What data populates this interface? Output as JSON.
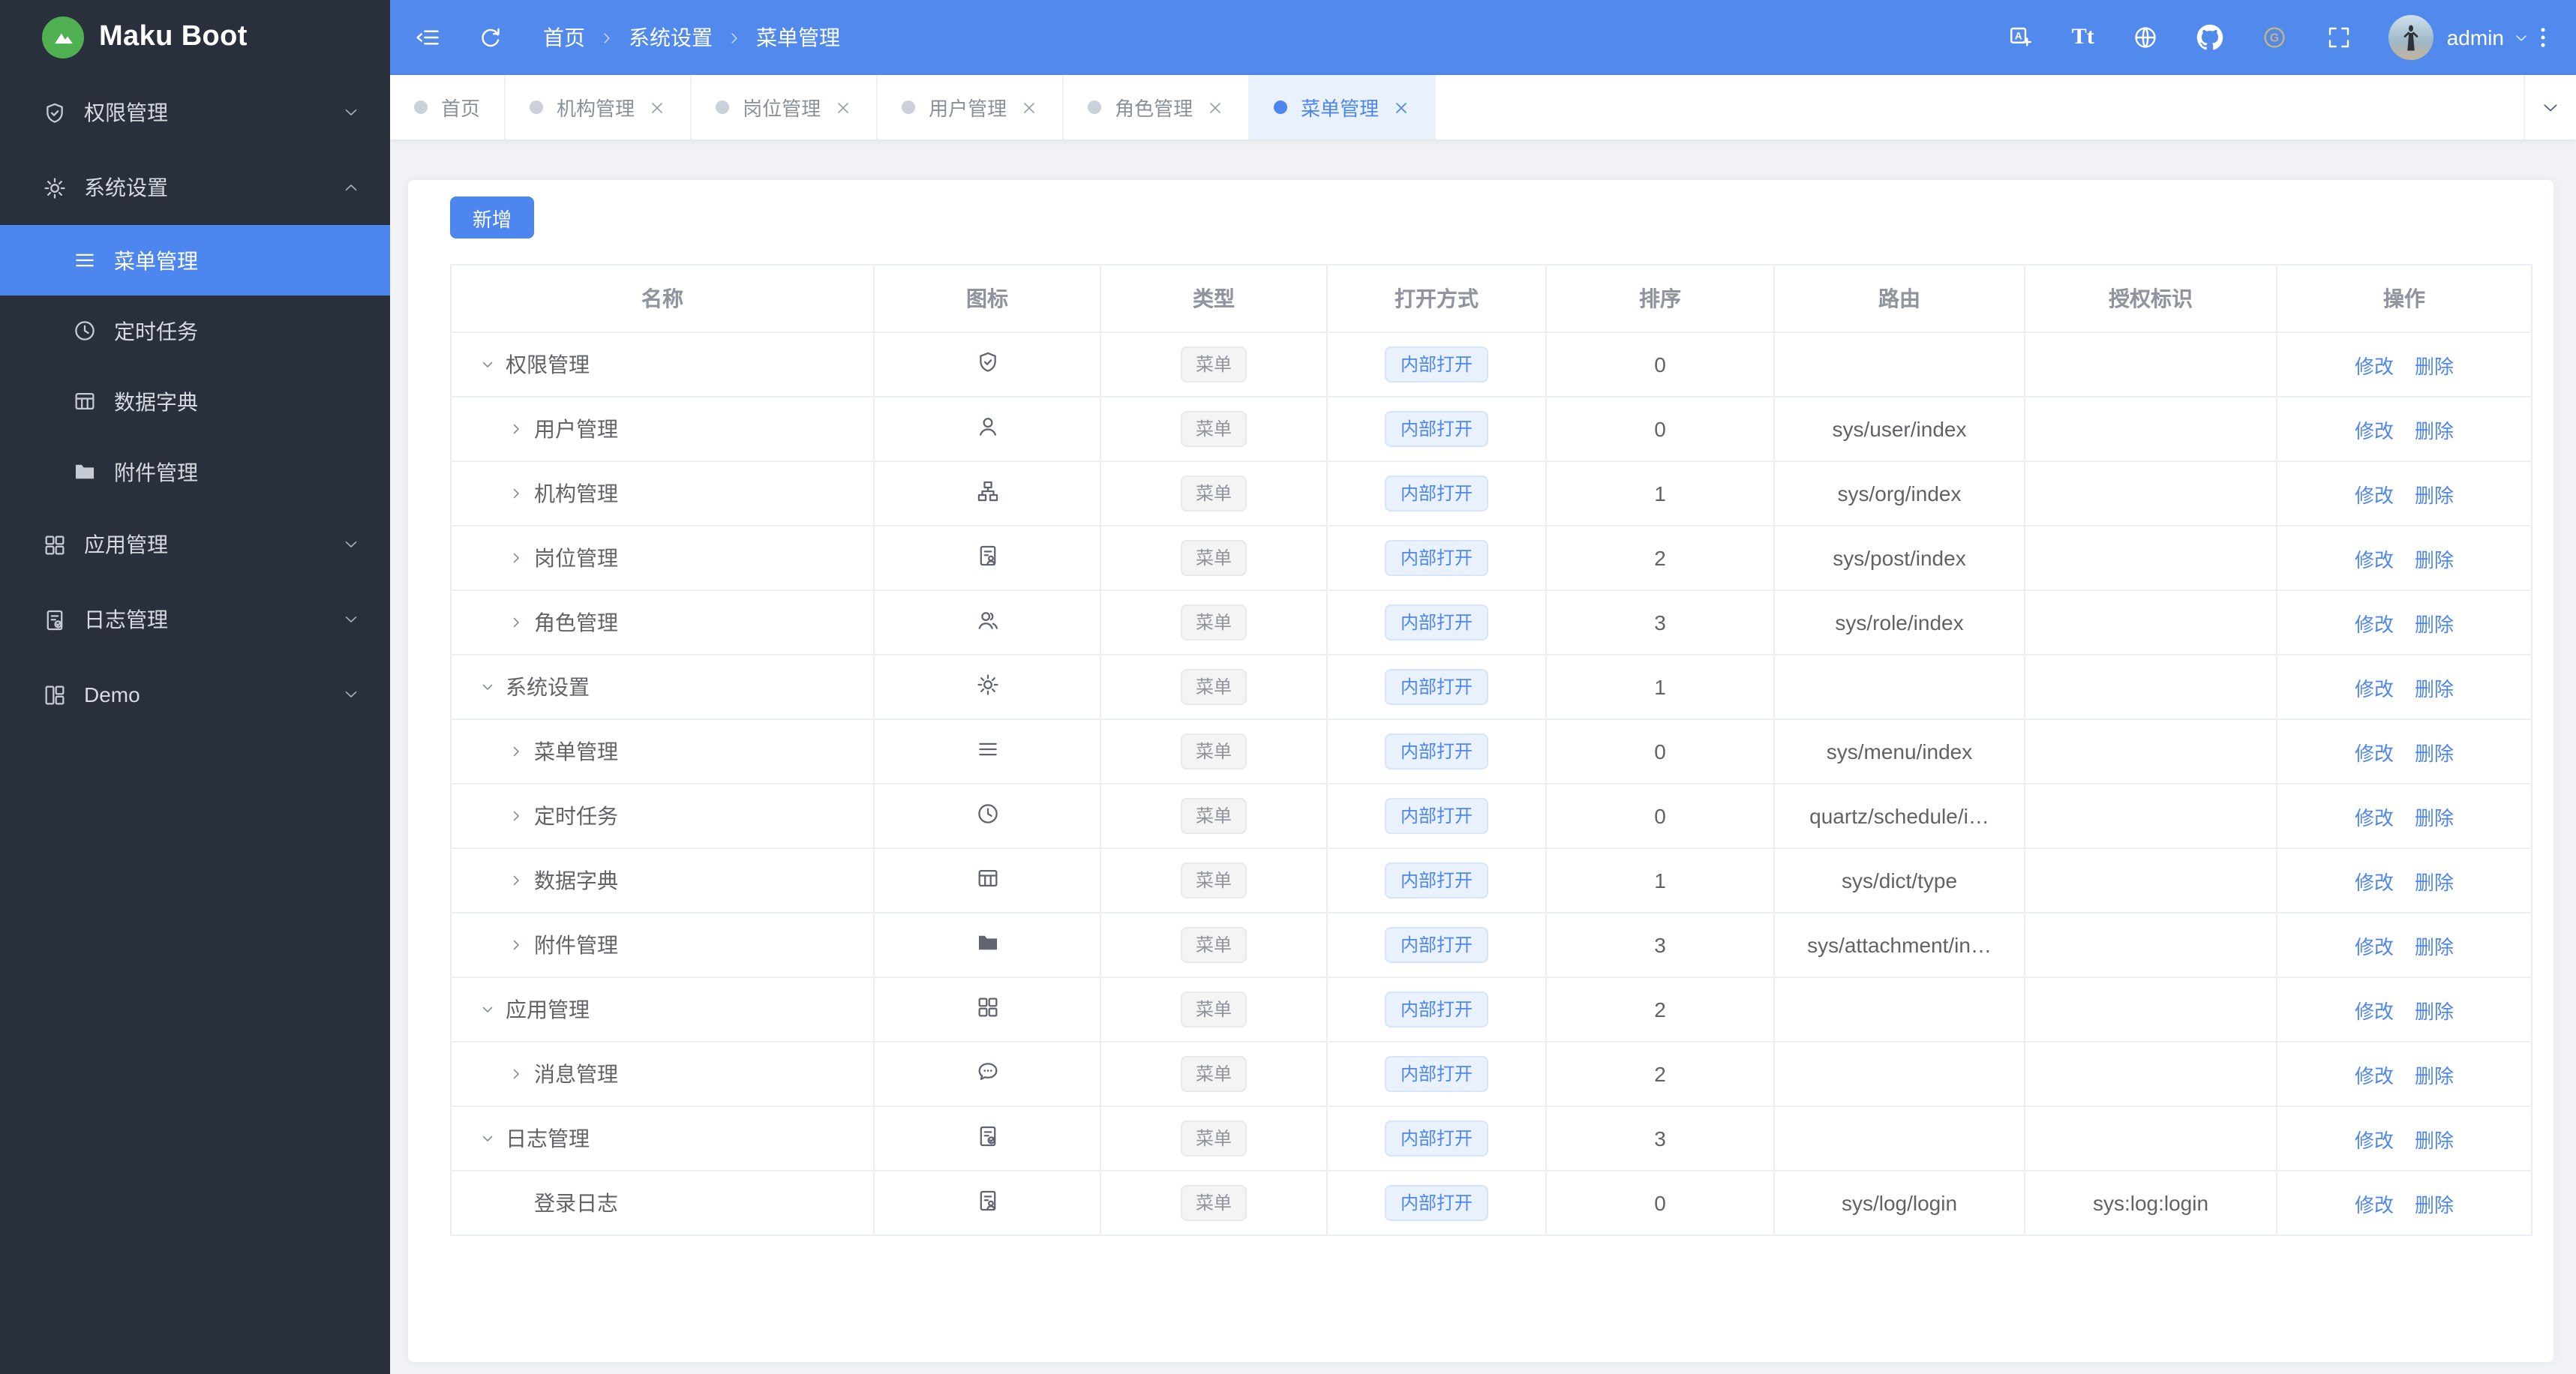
{
  "app": {
    "name": "Maku Boot"
  },
  "colors": {
    "accent": "#4e86f0",
    "header_bg": "#5289ec",
    "sidebar_bg": "#2a303b",
    "sidebar_active_bg": "#4e86f0",
    "logo_green": "#4fb051",
    "gitee_gold": "#c9b37f",
    "active_tab_bg": "#e9f1fd",
    "page_bg": "#f0f2f5"
  },
  "header": {
    "breadcrumb": [
      "首页",
      "系统设置",
      "菜单管理"
    ],
    "left_icons": [
      "collapse-sidebar-icon",
      "refresh-icon"
    ],
    "tools": [
      {
        "icon": "translate-icon"
      },
      {
        "icon": "font-size-icon",
        "text": "Tt"
      },
      {
        "icon": "globe-icon"
      },
      {
        "icon": "github-icon"
      },
      {
        "icon": "gitee-icon"
      },
      {
        "icon": "fullscreen-icon"
      }
    ],
    "user_name": "admin"
  },
  "sidebar": {
    "items": [
      {
        "key": "auth",
        "label": "权限管理",
        "icon": "shield-check-icon",
        "expandable": true,
        "expanded": false
      },
      {
        "key": "system",
        "label": "系统设置",
        "icon": "gear-icon",
        "expandable": true,
        "expanded": true,
        "children": [
          {
            "key": "menu",
            "label": "菜单管理",
            "icon": "menu-icon",
            "active": true
          },
          {
            "key": "schedule",
            "label": "定时任务",
            "icon": "clock-icon",
            "active": false
          },
          {
            "key": "dict",
            "label": "数据字典",
            "icon": "dict-icon",
            "active": false
          },
          {
            "key": "attachment",
            "label": "附件管理",
            "icon": "folder-icon",
            "active": false
          }
        ]
      },
      {
        "key": "app",
        "label": "应用管理",
        "icon": "apps-icon",
        "expandable": true,
        "expanded": false
      },
      {
        "key": "log",
        "label": "日志管理",
        "icon": "log-icon",
        "expandable": true,
        "expanded": false
      },
      {
        "key": "demo",
        "label": "Demo",
        "icon": "demo-icon",
        "expandable": true,
        "expanded": false
      }
    ]
  },
  "tabbar": {
    "tabs": [
      {
        "key": "home",
        "label": "首页",
        "closable": false,
        "active": false
      },
      {
        "key": "org",
        "label": "机构管理",
        "closable": true,
        "active": false
      },
      {
        "key": "post",
        "label": "岗位管理",
        "closable": true,
        "active": false
      },
      {
        "key": "user",
        "label": "用户管理",
        "closable": true,
        "active": false
      },
      {
        "key": "role",
        "label": "角色管理",
        "closable": true,
        "active": false
      },
      {
        "key": "menu",
        "label": "菜单管理",
        "closable": true,
        "active": true
      }
    ]
  },
  "content": {
    "add_button": "新增",
    "table": {
      "columns": [
        "名称",
        "图标",
        "类型",
        "打开方式",
        "排序",
        "路由",
        "授权标识",
        "操作"
      ],
      "actions": [
        "修改",
        "删除"
      ],
      "rows": [
        {
          "name": "权限管理",
          "level": 1,
          "expand": "down",
          "icon": "shield-check-icon",
          "type": "菜单",
          "open": "内部打开",
          "sort": "0",
          "route": "",
          "perm": ""
        },
        {
          "name": "用户管理",
          "level": 2,
          "expand": "right",
          "icon": "user-icon",
          "type": "菜单",
          "open": "内部打开",
          "sort": "0",
          "route": "sys/user/index",
          "perm": ""
        },
        {
          "name": "机构管理",
          "level": 2,
          "expand": "right",
          "icon": "org-icon",
          "type": "菜单",
          "open": "内部打开",
          "sort": "1",
          "route": "sys/org/index",
          "perm": ""
        },
        {
          "name": "岗位管理",
          "level": 2,
          "expand": "right",
          "icon": "post-icon",
          "type": "菜单",
          "open": "内部打开",
          "sort": "2",
          "route": "sys/post/index",
          "perm": ""
        },
        {
          "name": "角色管理",
          "level": 2,
          "expand": "right",
          "icon": "role-icon",
          "type": "菜单",
          "open": "内部打开",
          "sort": "3",
          "route": "sys/role/index",
          "perm": ""
        },
        {
          "name": "系统设置",
          "level": 1,
          "expand": "down",
          "icon": "gear-icon",
          "type": "菜单",
          "open": "内部打开",
          "sort": "1",
          "route": "",
          "perm": ""
        },
        {
          "name": "菜单管理",
          "level": 2,
          "expand": "right",
          "icon": "menu-icon",
          "type": "菜单",
          "open": "内部打开",
          "sort": "0",
          "route": "sys/menu/index",
          "perm": ""
        },
        {
          "name": "定时任务",
          "level": 2,
          "expand": "right",
          "icon": "clock-icon",
          "type": "菜单",
          "open": "内部打开",
          "sort": "0",
          "route": "quartz/schedule/i…",
          "perm": ""
        },
        {
          "name": "数据字典",
          "level": 2,
          "expand": "right",
          "icon": "dict-icon",
          "type": "菜单",
          "open": "内部打开",
          "sort": "1",
          "route": "sys/dict/type",
          "perm": ""
        },
        {
          "name": "附件管理",
          "level": 2,
          "expand": "right",
          "icon": "folder-icon",
          "type": "菜单",
          "open": "内部打开",
          "sort": "3",
          "route": "sys/attachment/in…",
          "perm": ""
        },
        {
          "name": "应用管理",
          "level": 1,
          "expand": "down",
          "icon": "apps-icon",
          "type": "菜单",
          "open": "内部打开",
          "sort": "2",
          "route": "",
          "perm": ""
        },
        {
          "name": "消息管理",
          "level": 2,
          "expand": "right",
          "icon": "message-icon",
          "type": "菜单",
          "open": "内部打开",
          "sort": "2",
          "route": "",
          "perm": ""
        },
        {
          "name": "日志管理",
          "level": 1,
          "expand": "down",
          "icon": "log-icon",
          "type": "菜单",
          "open": "内部打开",
          "sort": "3",
          "route": "",
          "perm": ""
        },
        {
          "name": "登录日志",
          "level": 3,
          "expand": null,
          "icon": "post-icon",
          "type": "菜单",
          "open": "内部打开",
          "sort": "0",
          "route": "sys/log/login",
          "perm": "sys:log:login"
        }
      ]
    }
  }
}
